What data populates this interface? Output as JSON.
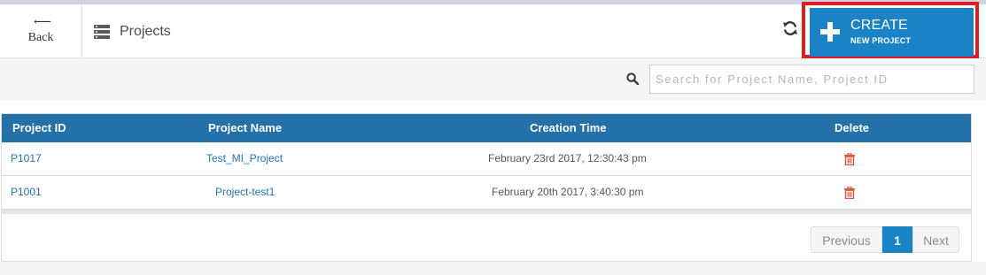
{
  "header": {
    "back_label": "Back",
    "back_arrow": "⟵",
    "title": "Projects",
    "create_line1": "CREATE",
    "create_line2": "NEW PROJECT"
  },
  "search": {
    "placeholder": "Search for Project Name, Project ID",
    "value": ""
  },
  "table": {
    "columns": [
      "Project ID",
      "Project Name",
      "Creation Time",
      "Delete"
    ],
    "rows": [
      {
        "id": "P1017",
        "name": "Test_MI_Project",
        "time": "February 23rd 2017, 12:30:43 pm"
      },
      {
        "id": "P1001",
        "name": "Project-test1",
        "time": "February 20th 2017, 3:40:30 pm"
      }
    ]
  },
  "pagination": {
    "prev": "Previous",
    "current": "1",
    "next": "Next"
  },
  "colors": {
    "accent": "#1a83c6",
    "header_bg": "#2471aa",
    "highlight": "#e21b23",
    "delete": "#e0553a"
  },
  "icons": [
    "server-icon",
    "refresh-icon",
    "plus-icon",
    "search-icon",
    "trash-icon"
  ]
}
